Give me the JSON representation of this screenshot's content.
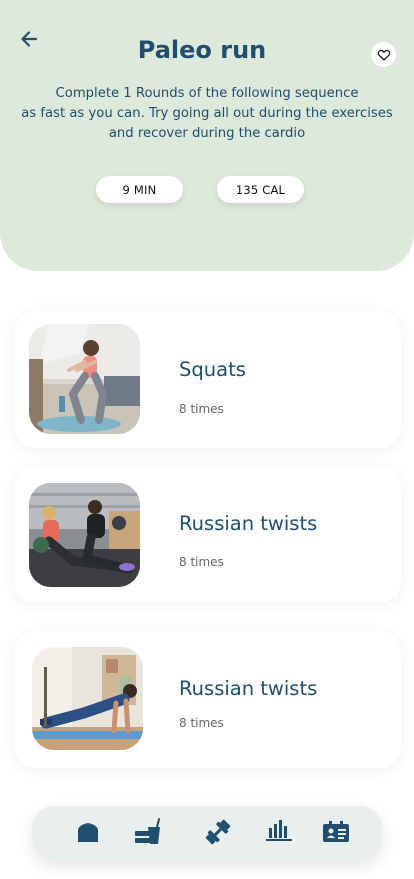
{
  "header": {
    "title": "Paleo run",
    "description_lines": [
      "Complete 1 Rounds of the following sequence",
      "as fast as you can. Try going all out during the exercises",
      "and recover during the cardio"
    ],
    "duration": "9 MIN",
    "calories": "135 CAL"
  },
  "exercises": [
    {
      "name": "Squats",
      "reps": "8 times",
      "image": "woman-squatting-photo"
    },
    {
      "name": "Russian twists",
      "reps": "8 times",
      "image": "gym-russian-twist-photo"
    },
    {
      "name": "Russian twists",
      "reps": "8 times",
      "image": "man-pushup-photo"
    }
  ],
  "nav": {
    "items": [
      "home-icon",
      "nutrition-icon",
      "workout-icon",
      "stats-icon",
      "profile-card-icon"
    ]
  },
  "colors": {
    "primary": "#1f4e6e",
    "header_bg": "#dde9da",
    "nav_bg": "#e9eeee"
  }
}
